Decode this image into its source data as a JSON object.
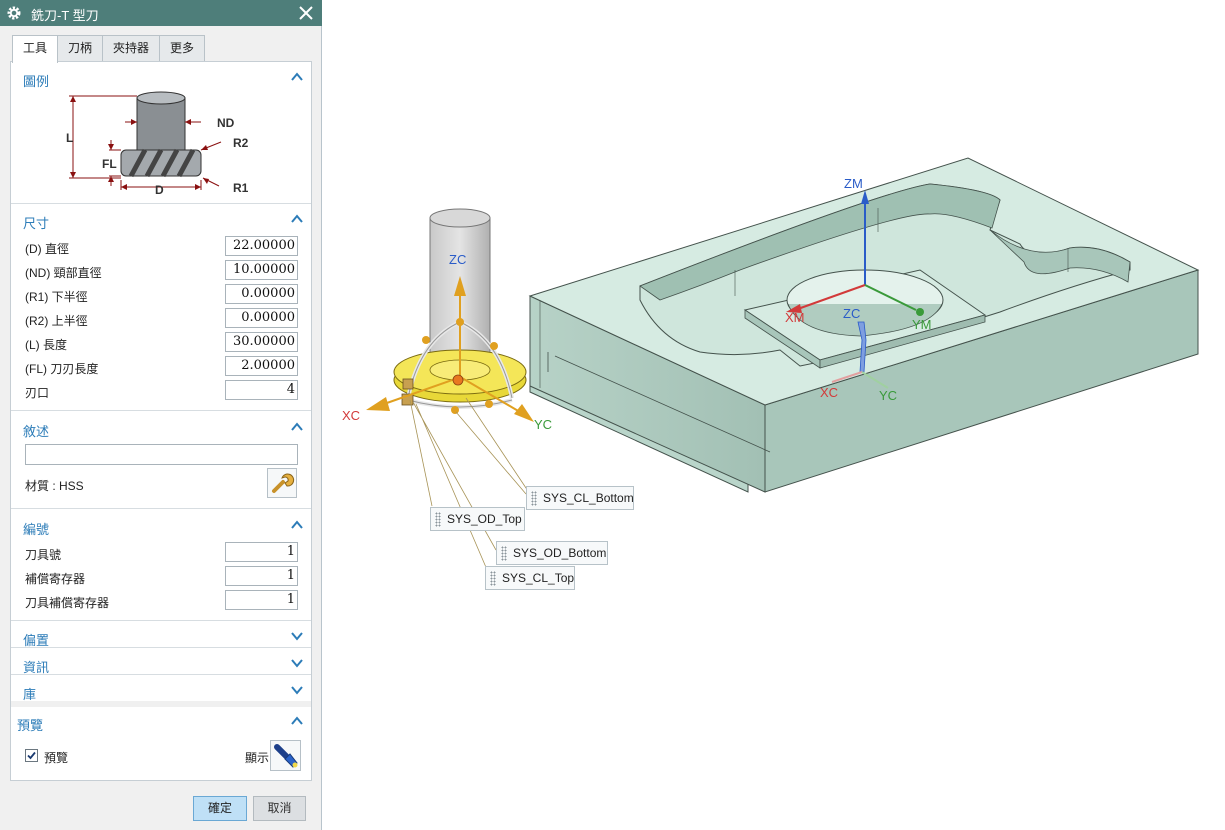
{
  "dialog": {
    "title": "銑刀-T 型刀",
    "tabs": [
      {
        "label": "工具",
        "active": true
      },
      {
        "label": "刀柄",
        "active": false
      },
      {
        "label": "夾持器",
        "active": false
      },
      {
        "label": "更多",
        "active": false
      }
    ],
    "sections": {
      "legend": {
        "title": "圖例",
        "labels": {
          "L": "L",
          "FL": "FL",
          "ND": "ND",
          "R2": "R2",
          "D": "D",
          "R1": "R1"
        }
      },
      "dimensions": {
        "title": "尺寸",
        "rows": [
          {
            "label": "(D) 直徑",
            "value": "22.00000"
          },
          {
            "label": "(ND) 頸部直徑",
            "value": "10.00000"
          },
          {
            "label": "(R1) 下半徑",
            "value": "0.00000"
          },
          {
            "label": "(R2) 上半徑",
            "value": "0.00000"
          },
          {
            "label": "(L) 長度",
            "value": "30.00000"
          },
          {
            "label": "(FL) 刀刃長度",
            "value": "2.00000"
          },
          {
            "label": "刃口",
            "value": "4"
          }
        ]
      },
      "description": {
        "title": "敘述",
        "text_value": "",
        "material_label": "材質 : HSS"
      },
      "numbers": {
        "title": "編號",
        "rows": [
          {
            "label": "刀具號",
            "value": "1"
          },
          {
            "label": "補償寄存器",
            "value": "1"
          },
          {
            "label": "刀具補償寄存器",
            "value": "1"
          }
        ]
      },
      "offset": {
        "title": "偏置"
      },
      "info": {
        "title": "資訊"
      },
      "library": {
        "title": "庫"
      },
      "preview": {
        "title": "預覽",
        "checkbox_label": "預覽",
        "checked": true,
        "display_label": "顯示"
      }
    },
    "buttons": {
      "ok": "確定",
      "cancel": "取消"
    }
  },
  "viewport": {
    "axes": {
      "zc": "ZC",
      "xc": "XC",
      "yc": "YC",
      "zm": "ZM",
      "xm": "XM",
      "ym": "YM",
      "zc2": "ZC",
      "xc2": "XC",
      "yc2": "YC"
    },
    "tags": [
      "SYS_CL_Bottom",
      "SYS_OD_Top",
      "SYS_OD_Bottom",
      "SYS_CL_Top"
    ],
    "colors": {
      "x_axis": "#d23a3a",
      "y_axis": "#3a9a3a",
      "z_axis": "#2a5cc8",
      "part": "#cfe6dc",
      "tool_yellow": "#f0e24a",
      "handle": "#e0a020"
    }
  }
}
